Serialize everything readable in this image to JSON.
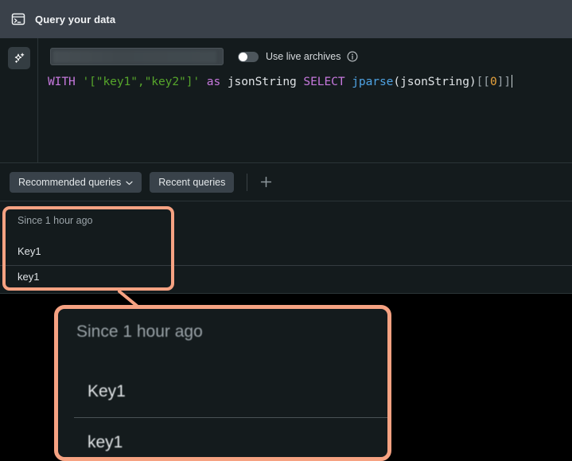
{
  "header": {
    "title": "Query your data",
    "icon": "terminal-icon"
  },
  "editor": {
    "ai_button_icon": "sparkle-icon",
    "search": {
      "value": "",
      "placeholder": ""
    },
    "live_archives": {
      "label": "Use live archives",
      "state": "off",
      "info_icon": "info-icon"
    },
    "query": {
      "full_text": "WITH '[\"key1\",\"key2\"]' as jsonString SELECT jparse(jsonString)[0]",
      "tokens": [
        {
          "text": "WITH",
          "type": "keyword"
        },
        {
          "text": " ",
          "type": "plain"
        },
        {
          "text": "'[\"key1\",\"key2\"]'",
          "type": "string"
        },
        {
          "text": " ",
          "type": "plain"
        },
        {
          "text": "as",
          "type": "keyword"
        },
        {
          "text": " jsonString ",
          "type": "plain"
        },
        {
          "text": "SELECT",
          "type": "keyword"
        },
        {
          "text": " ",
          "type": "plain"
        },
        {
          "text": "jparse",
          "type": "function"
        },
        {
          "text": "(jsonString)",
          "type": "plain"
        },
        {
          "text": "[",
          "type": "bracket"
        },
        {
          "text": "[",
          "type": "bracket"
        },
        {
          "text": "0",
          "type": "number"
        },
        {
          "text": "]",
          "type": "bracket"
        },
        {
          "text": "]",
          "type": "bracket"
        }
      ]
    }
  },
  "toolbar": {
    "recommended_label": "Recommended queries",
    "recent_label": "Recent queries",
    "add_label": "+"
  },
  "results": {
    "caption": "Since 1 hour ago",
    "columns": [
      "Key1"
    ],
    "rows": [
      [
        "key1"
      ]
    ]
  },
  "annotation": {
    "highlight_color": "#f6a282",
    "magnified": {
      "caption": "Since 1 hour ago",
      "column": "Key1",
      "value": "key1"
    }
  }
}
